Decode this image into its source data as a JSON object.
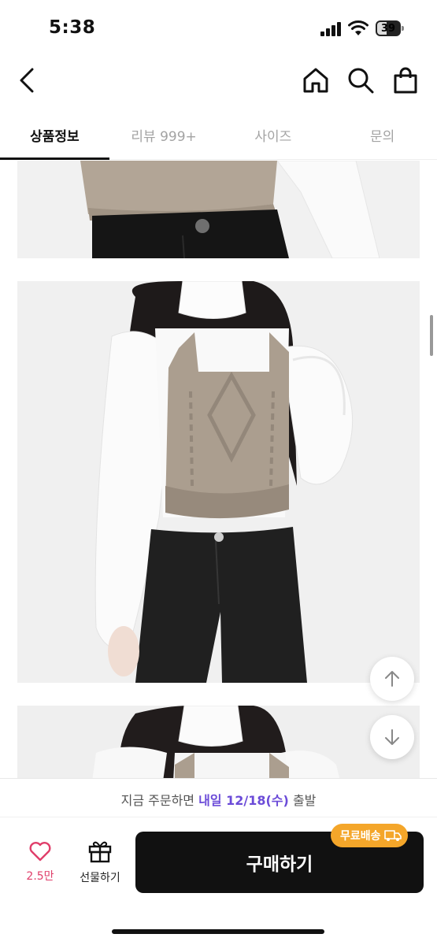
{
  "status": {
    "time": "5:38",
    "battery": "39"
  },
  "nav": {
    "back_icon": "chevron-left-icon",
    "home_icon": "home-icon",
    "search_icon": "search-icon",
    "bag_icon": "shopping-bag-icon"
  },
  "tabs": [
    {
      "label": "상품정보",
      "active": true
    },
    {
      "label": "리뷰 999+",
      "active": false
    },
    {
      "label": "사이즈",
      "active": false
    },
    {
      "label": "문의",
      "active": false
    }
  ],
  "shipping": {
    "prefix": "지금 주문하면",
    "highlight": "내일 12/18(수)",
    "suffix": "출발"
  },
  "actions": {
    "like_count": "2.5만",
    "gift_label": "선물하기",
    "buy_label": "구매하기",
    "free_shipping_badge": "무료배송"
  },
  "colors": {
    "accent_purple": "#6b4bd8",
    "badge_orange": "#f4a62a",
    "like_pink": "#e03e6a",
    "buy_button": "#111111"
  }
}
